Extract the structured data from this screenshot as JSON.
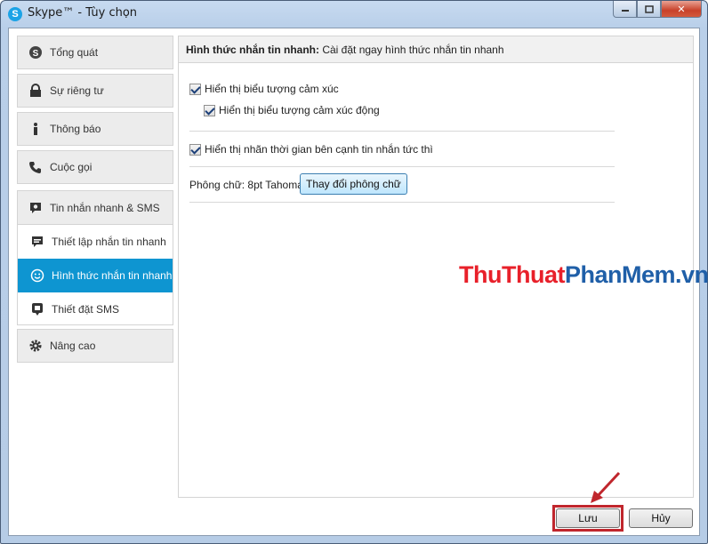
{
  "window": {
    "title": "Skype™ - Tùy chọn",
    "app_icon": "S",
    "close_symbol": "✕"
  },
  "sidebar": {
    "items": [
      {
        "label": "Tổng quát",
        "icon": "skype-icon"
      },
      {
        "label": "Sự riêng tư",
        "icon": "lock-icon"
      },
      {
        "label": "Thông báo",
        "icon": "info-icon"
      },
      {
        "label": "Cuộc gọi",
        "icon": "phone-icon"
      }
    ],
    "group": {
      "label": "Tin nhắn nhanh & SMS",
      "icon": "gear-chat-icon",
      "sub_items": [
        {
          "label": "Thiết lập nhắn tin nhanh",
          "icon": "speech-bubble-icon"
        },
        {
          "label": "Hình thức nhắn tin nhanh",
          "icon": "smiley-icon",
          "active": true
        },
        {
          "label": "Thiết đặt SMS",
          "icon": "sms-icon"
        }
      ]
    },
    "advanced": {
      "label": "Nâng cao",
      "icon": "gear-icon"
    }
  },
  "content": {
    "header_bold": "Hình thức nhắn tin nhanh:",
    "header_desc": " Cài đặt ngay hình thức nhắn tin nhanh",
    "options": [
      {
        "label": "Hiển thị biểu tượng cảm xúc",
        "checked": true
      },
      {
        "label": "Hiển thị biểu tượng cảm xúc động",
        "checked": true
      },
      {
        "label": "Hiển thị nhãn thời gian bên cạnh tin nhắn tức thì",
        "checked": true
      }
    ],
    "font_label": "Phông chữ: 8pt Tahoma",
    "font_button": "Thay đổi phông chữ"
  },
  "watermark": {
    "part1": "ThuThuat",
    "part2": "PhanMem",
    "part3": ".vn"
  },
  "footer": {
    "save_label": "Lưu",
    "cancel_label": "Hủy"
  },
  "colors": {
    "accent": "#0e95d1",
    "highlight": "#c0262d"
  }
}
